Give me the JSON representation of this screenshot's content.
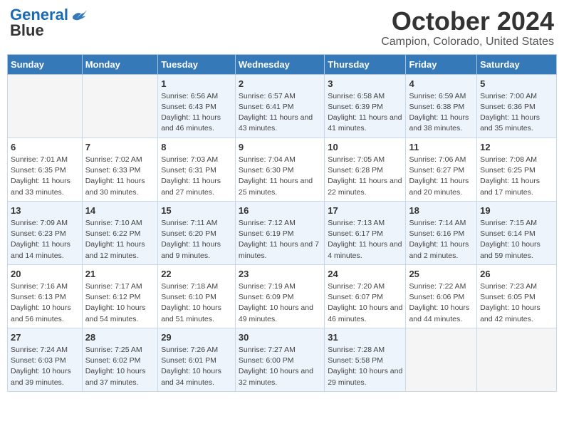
{
  "logo": {
    "line1": "General",
    "line2": "Blue"
  },
  "title": "October 2024",
  "subtitle": "Campion, Colorado, United States",
  "days_of_week": [
    "Sunday",
    "Monday",
    "Tuesday",
    "Wednesday",
    "Thursday",
    "Friday",
    "Saturday"
  ],
  "weeks": [
    [
      {
        "day": "",
        "info": ""
      },
      {
        "day": "",
        "info": ""
      },
      {
        "day": "1",
        "info": "Sunrise: 6:56 AM\nSunset: 6:43 PM\nDaylight: 11 hours and 46 minutes."
      },
      {
        "day": "2",
        "info": "Sunrise: 6:57 AM\nSunset: 6:41 PM\nDaylight: 11 hours and 43 minutes."
      },
      {
        "day": "3",
        "info": "Sunrise: 6:58 AM\nSunset: 6:39 PM\nDaylight: 11 hours and 41 minutes."
      },
      {
        "day": "4",
        "info": "Sunrise: 6:59 AM\nSunset: 6:38 PM\nDaylight: 11 hours and 38 minutes."
      },
      {
        "day": "5",
        "info": "Sunrise: 7:00 AM\nSunset: 6:36 PM\nDaylight: 11 hours and 35 minutes."
      }
    ],
    [
      {
        "day": "6",
        "info": "Sunrise: 7:01 AM\nSunset: 6:35 PM\nDaylight: 11 hours and 33 minutes."
      },
      {
        "day": "7",
        "info": "Sunrise: 7:02 AM\nSunset: 6:33 PM\nDaylight: 11 hours and 30 minutes."
      },
      {
        "day": "8",
        "info": "Sunrise: 7:03 AM\nSunset: 6:31 PM\nDaylight: 11 hours and 27 minutes."
      },
      {
        "day": "9",
        "info": "Sunrise: 7:04 AM\nSunset: 6:30 PM\nDaylight: 11 hours and 25 minutes."
      },
      {
        "day": "10",
        "info": "Sunrise: 7:05 AM\nSunset: 6:28 PM\nDaylight: 11 hours and 22 minutes."
      },
      {
        "day": "11",
        "info": "Sunrise: 7:06 AM\nSunset: 6:27 PM\nDaylight: 11 hours and 20 minutes."
      },
      {
        "day": "12",
        "info": "Sunrise: 7:08 AM\nSunset: 6:25 PM\nDaylight: 11 hours and 17 minutes."
      }
    ],
    [
      {
        "day": "13",
        "info": "Sunrise: 7:09 AM\nSunset: 6:23 PM\nDaylight: 11 hours and 14 minutes."
      },
      {
        "day": "14",
        "info": "Sunrise: 7:10 AM\nSunset: 6:22 PM\nDaylight: 11 hours and 12 minutes."
      },
      {
        "day": "15",
        "info": "Sunrise: 7:11 AM\nSunset: 6:20 PM\nDaylight: 11 hours and 9 minutes."
      },
      {
        "day": "16",
        "info": "Sunrise: 7:12 AM\nSunset: 6:19 PM\nDaylight: 11 hours and 7 minutes."
      },
      {
        "day": "17",
        "info": "Sunrise: 7:13 AM\nSunset: 6:17 PM\nDaylight: 11 hours and 4 minutes."
      },
      {
        "day": "18",
        "info": "Sunrise: 7:14 AM\nSunset: 6:16 PM\nDaylight: 11 hours and 2 minutes."
      },
      {
        "day": "19",
        "info": "Sunrise: 7:15 AM\nSunset: 6:14 PM\nDaylight: 10 hours and 59 minutes."
      }
    ],
    [
      {
        "day": "20",
        "info": "Sunrise: 7:16 AM\nSunset: 6:13 PM\nDaylight: 10 hours and 56 minutes."
      },
      {
        "day": "21",
        "info": "Sunrise: 7:17 AM\nSunset: 6:12 PM\nDaylight: 10 hours and 54 minutes."
      },
      {
        "day": "22",
        "info": "Sunrise: 7:18 AM\nSunset: 6:10 PM\nDaylight: 10 hours and 51 minutes."
      },
      {
        "day": "23",
        "info": "Sunrise: 7:19 AM\nSunset: 6:09 PM\nDaylight: 10 hours and 49 minutes."
      },
      {
        "day": "24",
        "info": "Sunrise: 7:20 AM\nSunset: 6:07 PM\nDaylight: 10 hours and 46 minutes."
      },
      {
        "day": "25",
        "info": "Sunrise: 7:22 AM\nSunset: 6:06 PM\nDaylight: 10 hours and 44 minutes."
      },
      {
        "day": "26",
        "info": "Sunrise: 7:23 AM\nSunset: 6:05 PM\nDaylight: 10 hours and 42 minutes."
      }
    ],
    [
      {
        "day": "27",
        "info": "Sunrise: 7:24 AM\nSunset: 6:03 PM\nDaylight: 10 hours and 39 minutes."
      },
      {
        "day": "28",
        "info": "Sunrise: 7:25 AM\nSunset: 6:02 PM\nDaylight: 10 hours and 37 minutes."
      },
      {
        "day": "29",
        "info": "Sunrise: 7:26 AM\nSunset: 6:01 PM\nDaylight: 10 hours and 34 minutes."
      },
      {
        "day": "30",
        "info": "Sunrise: 7:27 AM\nSunset: 6:00 PM\nDaylight: 10 hours and 32 minutes."
      },
      {
        "day": "31",
        "info": "Sunrise: 7:28 AM\nSunset: 5:58 PM\nDaylight: 10 hours and 29 minutes."
      },
      {
        "day": "",
        "info": ""
      },
      {
        "day": "",
        "info": ""
      }
    ]
  ]
}
